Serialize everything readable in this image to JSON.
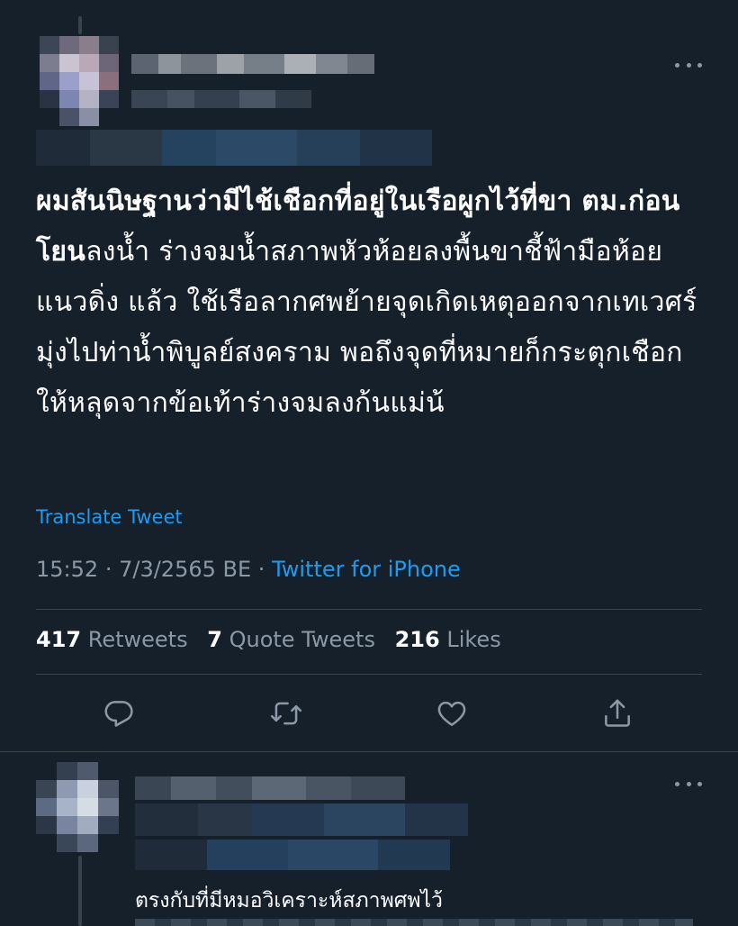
{
  "tweet": {
    "text_bold": "ผมสันนิษฐานว่ามีไช้เชือกที่อยู่ในเรือผูกไว้ที่ขา ตม.ก่อนโยน",
    "text_rest": "ลงน้ำ ร่างจมน้ำสภาพหัวห้อยลงพื้นขาชี้ฟ้ามือห้อยแนวดิ่ง แล้ว ใช้เรือลากศพย้ายจุดเกิดเหตุออกจากเทเวศร์มุ่งไปท่าน้ำพิบูลย์สงคราม พอถึงจุดที่หมายก็กระตุกเชือกให้หลุดจากข้อเท้าร่างจมลงก้นแม่น้",
    "translate_label": "Translate Tweet",
    "time": "15:52",
    "date": "7/3/2565 BE",
    "separator": "·",
    "source": "Twitter for iPhone"
  },
  "stats": {
    "retweets_count": "417",
    "retweets_label": "Retweets",
    "quotes_count": "7",
    "quotes_label": "Quote Tweets",
    "likes_count": "216",
    "likes_label": "Likes"
  },
  "actions": {
    "reply_icon": "reply-icon",
    "retweet_icon": "retweet-icon",
    "like_icon": "heart-icon",
    "share_icon": "share-icon"
  },
  "reply": {
    "text": "ตรงกับที่มีหมอวิเคราะห์สภาพศพไว้"
  },
  "colors": {
    "background": "#15202b",
    "accent": "#1d9bf0",
    "muted": "#8b98a5",
    "divider": "#38444d"
  }
}
